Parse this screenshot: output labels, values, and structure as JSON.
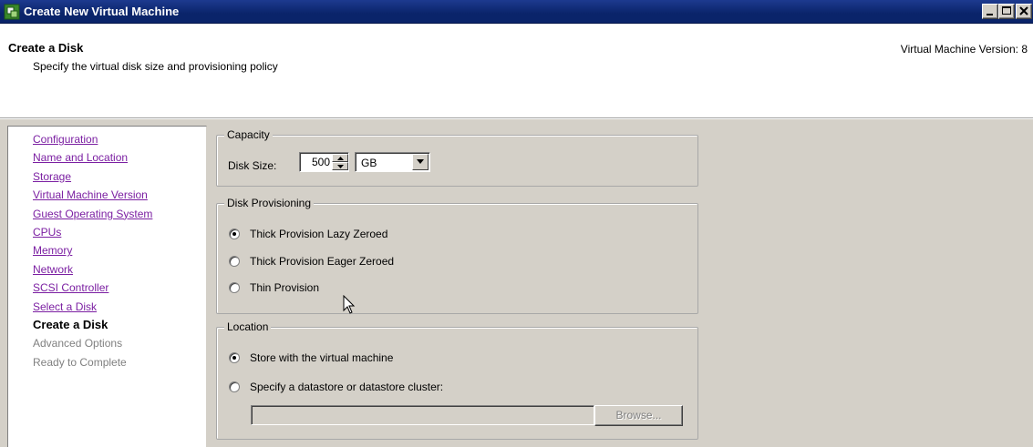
{
  "window": {
    "title": "Create New Virtual Machine"
  },
  "header": {
    "title": "Create a Disk",
    "subtitle": "Specify the virtual disk size and provisioning policy",
    "vm_version": "Virtual Machine Version: 8"
  },
  "sidebar": {
    "items": [
      {
        "label": "Configuration",
        "state": "link"
      },
      {
        "label": "Name and Location",
        "state": "link"
      },
      {
        "label": "Storage",
        "state": "link"
      },
      {
        "label": "Virtual Machine Version",
        "state": "link"
      },
      {
        "label": "Guest Operating System",
        "state": "link"
      },
      {
        "label": "CPUs",
        "state": "link"
      },
      {
        "label": "Memory",
        "state": "link"
      },
      {
        "label": "Network",
        "state": "link"
      },
      {
        "label": "SCSI Controller",
        "state": "link"
      },
      {
        "label": "Select a Disk",
        "state": "link"
      },
      {
        "label": "Create a Disk",
        "state": "current"
      },
      {
        "label": "Advanced Options",
        "state": "disabled"
      },
      {
        "label": "Ready to Complete",
        "state": "disabled"
      }
    ]
  },
  "capacity": {
    "legend": "Capacity",
    "disk_size_label": "Disk Size:",
    "disk_size_value": "500",
    "unit": "GB"
  },
  "provisioning": {
    "legend": "Disk Provisioning",
    "options": [
      {
        "label": "Thick Provision Lazy Zeroed",
        "checked": true
      },
      {
        "label": "Thick Provision Eager Zeroed",
        "checked": false
      },
      {
        "label": "Thin Provision",
        "checked": false
      }
    ]
  },
  "location": {
    "legend": "Location",
    "options": [
      {
        "label": "Store with the virtual machine",
        "checked": true
      },
      {
        "label": "Specify a datastore or datastore cluster:",
        "checked": false
      }
    ],
    "datastore_value": "",
    "browse_label": "Browse..."
  },
  "icons": {
    "app": "vm-wizard-icon",
    "minimize": "minimize-icon",
    "maximize": "maximize-icon",
    "close": "close-icon",
    "spin_up": "arrow-up-icon",
    "spin_down": "arrow-down-icon",
    "dropdown": "chevron-down-icon",
    "cursor": "mouse-pointer-icon"
  },
  "colors": {
    "titlebar": "#0a246a",
    "panel": "#d4d0c8",
    "link": "#7b1fa2"
  }
}
